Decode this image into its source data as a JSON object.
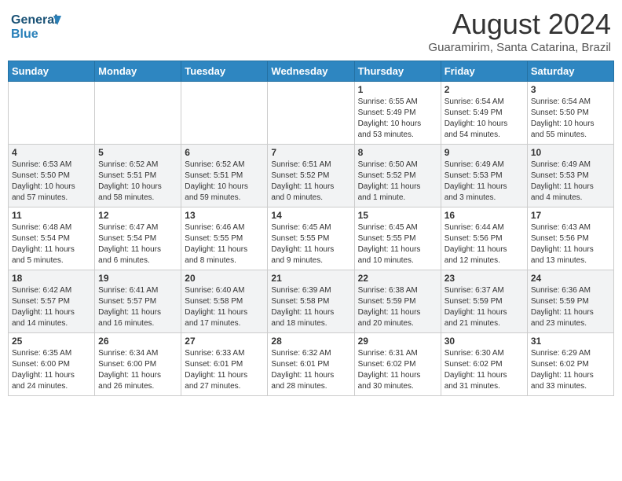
{
  "header": {
    "logo_line1": "General",
    "logo_line2": "Blue",
    "month_year": "August 2024",
    "location": "Guaramirim, Santa Catarina, Brazil"
  },
  "weekdays": [
    "Sunday",
    "Monday",
    "Tuesday",
    "Wednesday",
    "Thursday",
    "Friday",
    "Saturday"
  ],
  "weeks": [
    [
      {
        "day": "",
        "info": ""
      },
      {
        "day": "",
        "info": ""
      },
      {
        "day": "",
        "info": ""
      },
      {
        "day": "",
        "info": ""
      },
      {
        "day": "1",
        "info": "Sunrise: 6:55 AM\nSunset: 5:49 PM\nDaylight: 10 hours\nand 53 minutes."
      },
      {
        "day": "2",
        "info": "Sunrise: 6:54 AM\nSunset: 5:49 PM\nDaylight: 10 hours\nand 54 minutes."
      },
      {
        "day": "3",
        "info": "Sunrise: 6:54 AM\nSunset: 5:50 PM\nDaylight: 10 hours\nand 55 minutes."
      }
    ],
    [
      {
        "day": "4",
        "info": "Sunrise: 6:53 AM\nSunset: 5:50 PM\nDaylight: 10 hours\nand 57 minutes."
      },
      {
        "day": "5",
        "info": "Sunrise: 6:52 AM\nSunset: 5:51 PM\nDaylight: 10 hours\nand 58 minutes."
      },
      {
        "day": "6",
        "info": "Sunrise: 6:52 AM\nSunset: 5:51 PM\nDaylight: 10 hours\nand 59 minutes."
      },
      {
        "day": "7",
        "info": "Sunrise: 6:51 AM\nSunset: 5:52 PM\nDaylight: 11 hours\nand 0 minutes."
      },
      {
        "day": "8",
        "info": "Sunrise: 6:50 AM\nSunset: 5:52 PM\nDaylight: 11 hours\nand 1 minute."
      },
      {
        "day": "9",
        "info": "Sunrise: 6:49 AM\nSunset: 5:53 PM\nDaylight: 11 hours\nand 3 minutes."
      },
      {
        "day": "10",
        "info": "Sunrise: 6:49 AM\nSunset: 5:53 PM\nDaylight: 11 hours\nand 4 minutes."
      }
    ],
    [
      {
        "day": "11",
        "info": "Sunrise: 6:48 AM\nSunset: 5:54 PM\nDaylight: 11 hours\nand 5 minutes."
      },
      {
        "day": "12",
        "info": "Sunrise: 6:47 AM\nSunset: 5:54 PM\nDaylight: 11 hours\nand 6 minutes."
      },
      {
        "day": "13",
        "info": "Sunrise: 6:46 AM\nSunset: 5:55 PM\nDaylight: 11 hours\nand 8 minutes."
      },
      {
        "day": "14",
        "info": "Sunrise: 6:45 AM\nSunset: 5:55 PM\nDaylight: 11 hours\nand 9 minutes."
      },
      {
        "day": "15",
        "info": "Sunrise: 6:45 AM\nSunset: 5:55 PM\nDaylight: 11 hours\nand 10 minutes."
      },
      {
        "day": "16",
        "info": "Sunrise: 6:44 AM\nSunset: 5:56 PM\nDaylight: 11 hours\nand 12 minutes."
      },
      {
        "day": "17",
        "info": "Sunrise: 6:43 AM\nSunset: 5:56 PM\nDaylight: 11 hours\nand 13 minutes."
      }
    ],
    [
      {
        "day": "18",
        "info": "Sunrise: 6:42 AM\nSunset: 5:57 PM\nDaylight: 11 hours\nand 14 minutes."
      },
      {
        "day": "19",
        "info": "Sunrise: 6:41 AM\nSunset: 5:57 PM\nDaylight: 11 hours\nand 16 minutes."
      },
      {
        "day": "20",
        "info": "Sunrise: 6:40 AM\nSunset: 5:58 PM\nDaylight: 11 hours\nand 17 minutes."
      },
      {
        "day": "21",
        "info": "Sunrise: 6:39 AM\nSunset: 5:58 PM\nDaylight: 11 hours\nand 18 minutes."
      },
      {
        "day": "22",
        "info": "Sunrise: 6:38 AM\nSunset: 5:59 PM\nDaylight: 11 hours\nand 20 minutes."
      },
      {
        "day": "23",
        "info": "Sunrise: 6:37 AM\nSunset: 5:59 PM\nDaylight: 11 hours\nand 21 minutes."
      },
      {
        "day": "24",
        "info": "Sunrise: 6:36 AM\nSunset: 5:59 PM\nDaylight: 11 hours\nand 23 minutes."
      }
    ],
    [
      {
        "day": "25",
        "info": "Sunrise: 6:35 AM\nSunset: 6:00 PM\nDaylight: 11 hours\nand 24 minutes."
      },
      {
        "day": "26",
        "info": "Sunrise: 6:34 AM\nSunset: 6:00 PM\nDaylight: 11 hours\nand 26 minutes."
      },
      {
        "day": "27",
        "info": "Sunrise: 6:33 AM\nSunset: 6:01 PM\nDaylight: 11 hours\nand 27 minutes."
      },
      {
        "day": "28",
        "info": "Sunrise: 6:32 AM\nSunset: 6:01 PM\nDaylight: 11 hours\nand 28 minutes."
      },
      {
        "day": "29",
        "info": "Sunrise: 6:31 AM\nSunset: 6:02 PM\nDaylight: 11 hours\nand 30 minutes."
      },
      {
        "day": "30",
        "info": "Sunrise: 6:30 AM\nSunset: 6:02 PM\nDaylight: 11 hours\nand 31 minutes."
      },
      {
        "day": "31",
        "info": "Sunrise: 6:29 AM\nSunset: 6:02 PM\nDaylight: 11 hours\nand 33 minutes."
      }
    ]
  ]
}
